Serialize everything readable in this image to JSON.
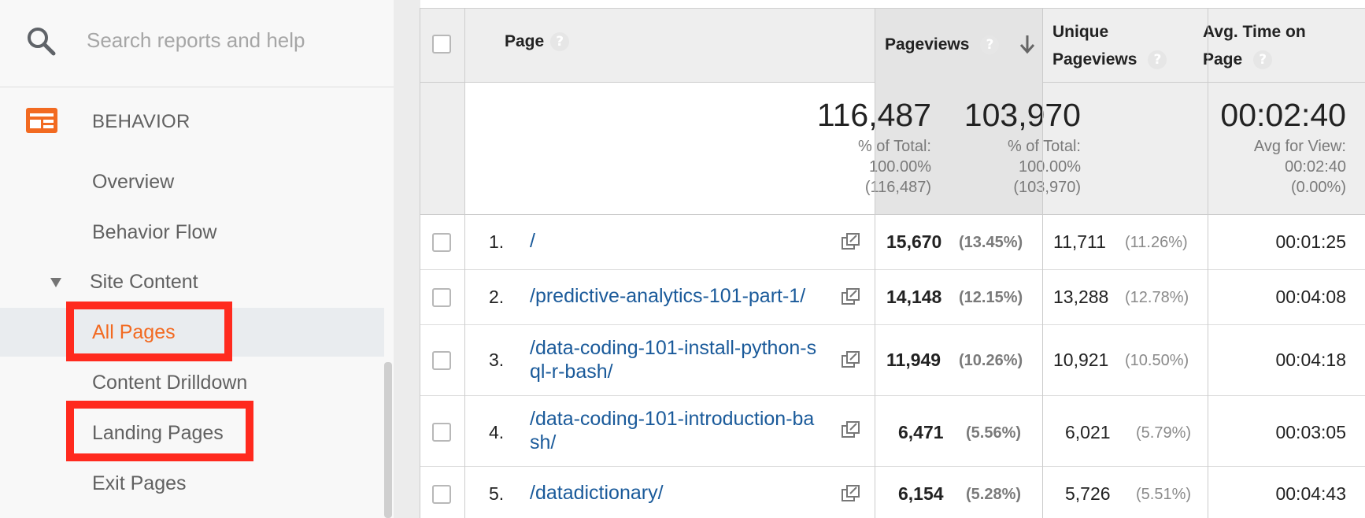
{
  "sidebar": {
    "search_placeholder": "Search reports and help",
    "section_title": "BEHAVIOR",
    "items": [
      {
        "label": "Overview"
      },
      {
        "label": "Behavior Flow"
      },
      {
        "label": "Site Content"
      },
      {
        "label": "All Pages"
      },
      {
        "label": "Content Drilldown"
      },
      {
        "label": "Landing Pages"
      },
      {
        "label": "Exit Pages"
      }
    ],
    "accent_color": "#f26a21",
    "highlight_color": "#ff2a1e"
  },
  "table": {
    "headers": {
      "page": "Page",
      "pageviews": "Pageviews",
      "unique_line1": "Unique",
      "unique_line2": "Pageviews",
      "avg_line1": "Avg. Time on",
      "avg_line2": "Page",
      "help": "?"
    },
    "totals": {
      "pageviews": "116,487",
      "pageviews_pct_label": "% of Total:",
      "pageviews_pct": "100.00%",
      "pageviews_of": "(116,487)",
      "unique": "103,970",
      "unique_pct_label": "% of Total:",
      "unique_pct": "100.00%",
      "unique_of": "(103,970)",
      "avg_time": "00:02:40",
      "avg_label": "Avg for View:",
      "avg_value": "00:02:40",
      "avg_diff": "(0.00%)"
    },
    "rows": [
      {
        "index": "1.",
        "page": "/",
        "pageviews": "15,670",
        "pageviews_pct": "(13.45%)",
        "unique": "11,711",
        "unique_pct": "(11.26%)",
        "avg_time": "00:01:25"
      },
      {
        "index": "2.",
        "page": "/predictive-analytics-101-part-1/",
        "pageviews": "14,148",
        "pageviews_pct": "(12.15%)",
        "unique": "13,288",
        "unique_pct": "(12.78%)",
        "avg_time": "00:04:08"
      },
      {
        "index": "3.",
        "page_line1": "/data-coding-101-install-python-s",
        "page_line2": "ql-r-bash/",
        "pageviews": "11,949",
        "pageviews_pct": "(10.26%)",
        "unique": "10,921",
        "unique_pct": "(10.50%)",
        "avg_time": "00:04:18"
      },
      {
        "index": "4.",
        "page_line1": "/data-coding-101-introduction-ba",
        "page_line2": "sh/",
        "pageviews": "6,471",
        "pageviews_pct": "(5.56%)",
        "unique": "6,021",
        "unique_pct": "(5.79%)",
        "avg_time": "00:03:05"
      },
      {
        "index": "5.",
        "page": "/datadictionary/",
        "pageviews": "6,154",
        "pageviews_pct": "(5.28%)",
        "unique": "5,726",
        "unique_pct": "(5.51%)",
        "avg_time": "00:04:43"
      }
    ],
    "link_color": "#1a5a9a"
  }
}
